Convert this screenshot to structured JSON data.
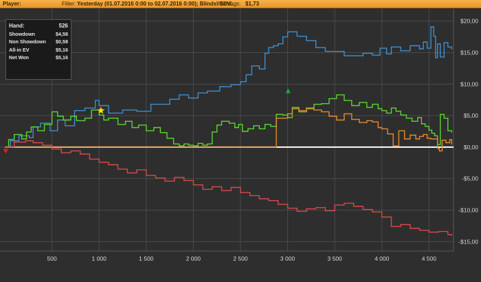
{
  "header": {
    "player_label": "Player:",
    "filter_label": "Filter:",
    "filter_value": "Yesterday (01.07.2016 0:00 to 02.07.2016 0:00); Blinds: $2NL",
    "winnings_label": "Winnings:",
    "winnings_value": "$1,73"
  },
  "stats": [
    {
      "label": "Hand:",
      "value": "526"
    },
    {
      "label": "Showdown",
      "value": "$4,58"
    },
    {
      "label": "Non Showdown",
      "value": "$0,58"
    },
    {
      "label": "All-in EV",
      "value": "$5,16"
    },
    {
      "label": "Net Won",
      "value": "$5,16"
    }
  ],
  "colors": {
    "background": "#2e2e2e",
    "grid": "#4a4a4a",
    "zero_line": "#ffffff",
    "net_won": "#3d8fd0",
    "all_in_ev": "#5bd62e",
    "showdown": "#e88a2c",
    "non_showdown": "#d84a4a",
    "highlight_star": "#ffe11a",
    "max_marker": "#1fa842",
    "min_marker": "#d81f1f"
  },
  "chart_data": {
    "type": "line",
    "xlim": [
      0,
      4760
    ],
    "ylim": [
      -16.5,
      21.5
    ],
    "x_ticks": [
      500,
      1000,
      1500,
      2000,
      2500,
      3000,
      3500,
      4000,
      4500
    ],
    "x_tick_labels": [
      "500",
      "1 000",
      "1 500",
      "2 000",
      "2 500",
      "3 000",
      "3 500",
      "4 000",
      "4 500"
    ],
    "y_ticks": [
      20,
      15,
      10,
      5,
      0,
      -5,
      -10,
      -15
    ],
    "y_tick_labels": [
      "$20,00",
      "$15,00",
      "$10,00",
      "$5,00",
      "$0,00",
      "-$5,00",
      "-$10,00",
      "-$15,00"
    ],
    "series": [
      {
        "color_key": "net_won",
        "x": [
          0,
          60,
          150,
          260,
          300,
          380,
          480,
          560,
          640,
          740,
          850,
          960,
          1000,
          1100,
          1250,
          1400,
          1550,
          1750,
          1850,
          1950,
          2050,
          2150,
          2280,
          2400,
          2500,
          2560,
          2620,
          2700,
          2760,
          2800,
          2850,
          2900,
          2950,
          3000,
          3100,
          3200,
          3300,
          3400,
          3600,
          3800,
          3900,
          3980,
          4050,
          4100,
          4200,
          4300,
          4400,
          4440,
          4480,
          4520,
          4550,
          4570,
          4590,
          4620,
          4660,
          4700,
          4740
        ],
        "y": [
          0,
          1.0,
          1.8,
          1.5,
          3.2,
          3.8,
          2.6,
          4.3,
          3.4,
          5.8,
          6.2,
          7.4,
          6.6,
          5.4,
          5.9,
          5.7,
          6.8,
          7.6,
          8.3,
          7.8,
          8.6,
          8.9,
          9.6,
          9.9,
          10.4,
          11.5,
          12.9,
          12.4,
          14.9,
          15.8,
          16.1,
          16.4,
          17.5,
          18.3,
          17.6,
          16.9,
          15.8,
          15.2,
          14.5,
          14.9,
          14.6,
          15.7,
          14.8,
          15.9,
          15.3,
          16.1,
          15.6,
          16.7,
          15.7,
          19.1,
          17.6,
          14.2,
          16.4,
          14.3,
          16.6,
          15.9,
          15.5
        ]
      },
      {
        "color_key": "all_in_ev",
        "x": [
          0,
          40,
          100,
          180,
          230,
          280,
          350,
          420,
          500,
          560,
          620,
          700,
          760,
          850,
          920,
          1000,
          1050,
          1100,
          1200,
          1280,
          1350,
          1420,
          1500,
          1580,
          1650,
          1720,
          1790,
          1850,
          1900,
          1950,
          2000,
          2050,
          2100,
          2150,
          2200,
          2250,
          2300,
          2380,
          2440,
          2480,
          2520,
          2580,
          2640,
          2700,
          2760,
          2820,
          2880,
          2950,
          3000,
          3050,
          3120,
          3200,
          3280,
          3360,
          3440,
          3520,
          3600,
          3680,
          3760,
          3840,
          3900,
          3960,
          4000,
          4050,
          4100,
          4150,
          4200,
          4260,
          4320,
          4380,
          4420,
          4460,
          4500,
          4530,
          4560,
          4590,
          4620,
          4660,
          4700,
          4740
        ],
        "y": [
          0,
          1.2,
          2.0,
          1.3,
          2.4,
          3.2,
          2.6,
          3.6,
          5.6,
          4.9,
          4.3,
          4.9,
          4.2,
          4.6,
          5.9,
          5.1,
          4.3,
          4.6,
          3.6,
          4.1,
          3.1,
          3.5,
          2.6,
          3.1,
          2.3,
          1.4,
          0.5,
          0.2,
          0.5,
          0.3,
          0.2,
          0.6,
          0.3,
          0.5,
          2.4,
          3.5,
          4.1,
          3.8,
          3.1,
          3.6,
          2.5,
          2.9,
          3.4,
          2.9,
          3.6,
          3.3,
          5.2,
          5.1,
          4.7,
          6.1,
          5.6,
          6.2,
          6.8,
          6.9,
          7.7,
          8.3,
          7.4,
          6.6,
          7.1,
          6.3,
          6.8,
          6.1,
          5.8,
          5.4,
          6.2,
          5.7,
          5.1,
          4.6,
          4.1,
          4.7,
          3.7,
          3.3,
          2.7,
          2.2,
          1.8,
          0.4,
          5.2,
          4.6,
          2.6,
          2.3
        ]
      },
      {
        "color_key": "showdown",
        "x": [
          0,
          2880,
          2950,
          3000,
          3050,
          3120,
          3200,
          3280,
          3360,
          3440,
          3520,
          3600,
          3680,
          3760,
          3840,
          3900,
          3960,
          4000,
          4060,
          4120,
          4180,
          4240,
          4300,
          4360,
          4400,
          4440,
          4480,
          4520,
          4560,
          4590,
          4610,
          4640,
          4680,
          4720,
          4740
        ],
        "y": [
          0,
          4.6,
          4.6,
          5.3,
          6.3,
          5.8,
          6.1,
          5.9,
          5.6,
          4.9,
          4.3,
          5.3,
          4.4,
          3.9,
          4.2,
          4.0,
          3.1,
          2.9,
          2.1,
          0.2,
          2.6,
          1.3,
          1.9,
          1.3,
          1.7,
          2.0,
          1.4,
          1.3,
          1.3,
          -0.2,
          -0.6,
          1.1,
          0.7,
          1.2,
          0.4
        ]
      },
      {
        "color_key": "non_showdown",
        "x": [
          0,
          100,
          220,
          300,
          400,
          500,
          600,
          700,
          800,
          900,
          1000,
          1100,
          1200,
          1300,
          1400,
          1500,
          1600,
          1700,
          1800,
          1900,
          2000,
          2100,
          2200,
          2300,
          2400,
          2500,
          2600,
          2700,
          2800,
          2900,
          3000,
          3100,
          3200,
          3300,
          3400,
          3500,
          3600,
          3700,
          3800,
          3900,
          4000,
          4100,
          4200,
          4300,
          4400,
          4500,
          4600,
          4700,
          4740
        ],
        "y": [
          0,
          0.8,
          1.0,
          0.7,
          0.3,
          -0.3,
          -0.9,
          -0.6,
          -1.1,
          -1.9,
          -2.4,
          -2.8,
          -3.5,
          -4.1,
          -3.6,
          -4.5,
          -4.9,
          -5.4,
          -4.8,
          -5.3,
          -6.0,
          -6.7,
          -6.3,
          -6.9,
          -6.4,
          -7.2,
          -7.7,
          -8.2,
          -8.5,
          -9.1,
          -9.7,
          -10.2,
          -9.8,
          -9.6,
          -10.1,
          -9.2,
          -8.9,
          -9.4,
          -9.9,
          -10.3,
          -11.1,
          -12.6,
          -12.3,
          -12.9,
          -13.2,
          -13.5,
          -13.4,
          -13.9,
          -14.1
        ]
      }
    ],
    "markers": [
      {
        "kind": "star",
        "color_key": "highlight_star",
        "x": 1020,
        "y": 5.8
      },
      {
        "kind": "triangle-up",
        "color_key": "max_marker",
        "x": 3005,
        "y": 8.9
      },
      {
        "kind": "triangle-down",
        "color_key": "min_marker",
        "x": 10,
        "y": -0.6
      }
    ]
  }
}
